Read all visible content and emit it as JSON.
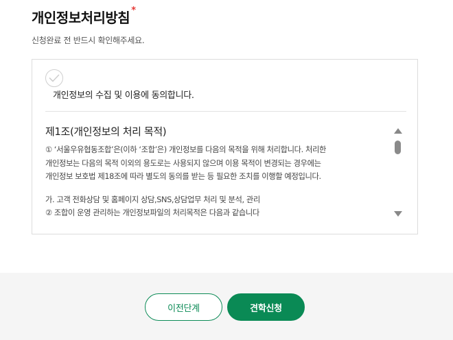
{
  "header": {
    "title": "개인정보처리방침",
    "required_mark": "*",
    "subtitle": "신청완료 전 반드시 확인해주세요."
  },
  "consent": {
    "checkbox_icon": "check-icon",
    "label": "개인정보의 수집 및 이용에 동의합니다."
  },
  "terms": {
    "heading": "제1조(개인정보의 처리 목적)",
    "lines": [
      "① ‘서울우유협동조합’은(이하 ‘조합’은) 개인정보를 다음의 목적을 위해 처리합니다. 처리한",
      "개인정보는 다음의 목적 이외의 용도로는 사용되지 않으며 이용 목적이 변경되는 경우에는",
      "개인정보 보호법 제18조에 따라 별도의 동의를 받는 등 필요한 조치를 이행할 예정입니다.",
      "가. 고객 전화상담 및 홈페이지 상담,SNS,상담업무 처리 및 분석, 관리",
      "② 조합이 운영 관리하는 개인정보파일의 처리목적은 다음과 같습니다"
    ]
  },
  "actions": {
    "prev_label": "이전단계",
    "submit_label": "견학신청"
  },
  "colors": {
    "accent": "#0a8a55",
    "required": "#e53935",
    "footer_bg": "#f5f5f5"
  }
}
